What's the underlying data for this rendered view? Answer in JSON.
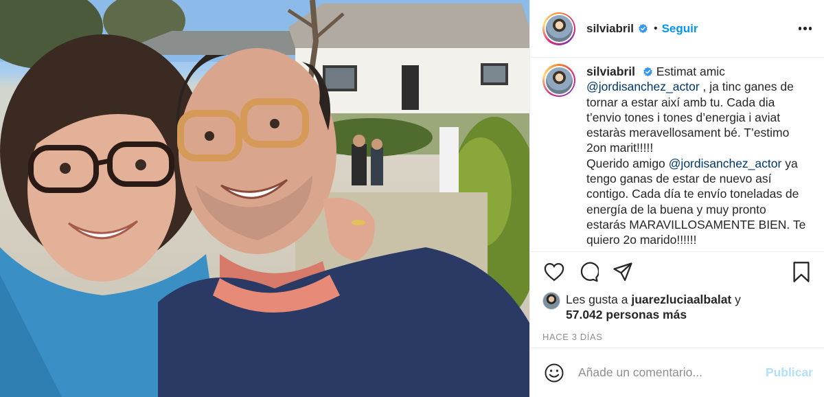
{
  "photo": {
    "alt_subject": "selfie"
  },
  "header": {
    "username": "silviabril",
    "separator": "•",
    "follow_label": "Seguir",
    "verified_icon": "verified-badge-icon",
    "more_icon": "more-options-icon"
  },
  "caption": {
    "username": "silviabril",
    "text_1": "Estimat amic",
    "mention_1": "@jordisanchez_actor",
    "text_2": ", ja tinc ganes de tornar a estar així amb tu. Cada dia t’envio tones i tones d’energia i aviat estaràs meravellosament bé. T’estimo 2on marit!!!!!",
    "text_3": "Querido amigo",
    "mention_2": "@jordisanchez_actor",
    "text_4": "ya tengo ganas de estar de nuevo así contigo. Cada día te envío toneladas de energía de la buena y muy pronto estarás MARAVILLOSAMENTE BIEN. Te quiero 2o marido!!!!!!"
  },
  "actions": {
    "like_icon": "heart-icon",
    "comment_icon": "comment-icon",
    "share_icon": "share-icon",
    "save_icon": "bookmark-icon"
  },
  "likes": {
    "prefix": "Les gusta a",
    "user": "juarezluciaalbalat",
    "conjunction": "y",
    "count_text": "57.042 personas más"
  },
  "timestamp": "HACE 3 DÍAS",
  "comment": {
    "placeholder": "Añade un comentario...",
    "publish_label": "Publicar",
    "emoji_icon": "emoji-icon"
  },
  "colors": {
    "accent": "#0095f6",
    "mention": "#00376b",
    "publish_disabled": "#b2dffc",
    "muted": "#8e8e8e"
  }
}
